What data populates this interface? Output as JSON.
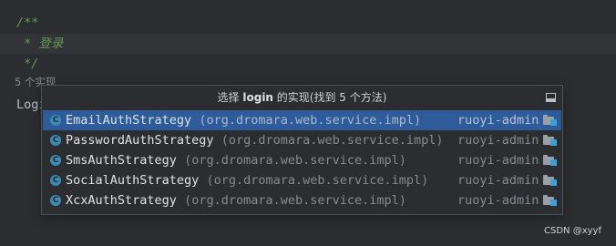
{
  "editor": {
    "lines": [
      "/**",
      " * 登录",
      " */"
    ],
    "hint": "5 个实现",
    "partial_code": "Logi"
  },
  "popup": {
    "header_prefix": "选择 ",
    "header_method": "login",
    "header_suffix": " 的实现(找到 5 个方法)",
    "items": [
      {
        "icon": "C",
        "class_name": "EmailAuthStrategy",
        "package": "(org.dromara.web.service.impl)",
        "module": "ruoyi-admin"
      },
      {
        "icon": "C",
        "class_name": "PasswordAuthStrategy",
        "package": "(org.dromara.web.service.impl)",
        "module": "ruoyi-admin"
      },
      {
        "icon": "C",
        "class_name": "SmsAuthStrategy",
        "package": "(org.dromara.web.service.impl)",
        "module": "ruoyi-admin"
      },
      {
        "icon": "C",
        "class_name": "SocialAuthStrategy",
        "package": "(org.dromara.web.service.impl)",
        "module": "ruoyi-admin"
      },
      {
        "icon": "C",
        "class_name": "XcxAuthStrategy",
        "package": "(org.dromara.web.service.impl)",
        "module": "ruoyi-admin"
      }
    ]
  },
  "watermark": "CSDN @xyyf",
  "colors": {
    "background": "#2b2d30",
    "comment": "#629755",
    "selection": "#2e5c9a",
    "class_icon": "#3d8bb3"
  }
}
